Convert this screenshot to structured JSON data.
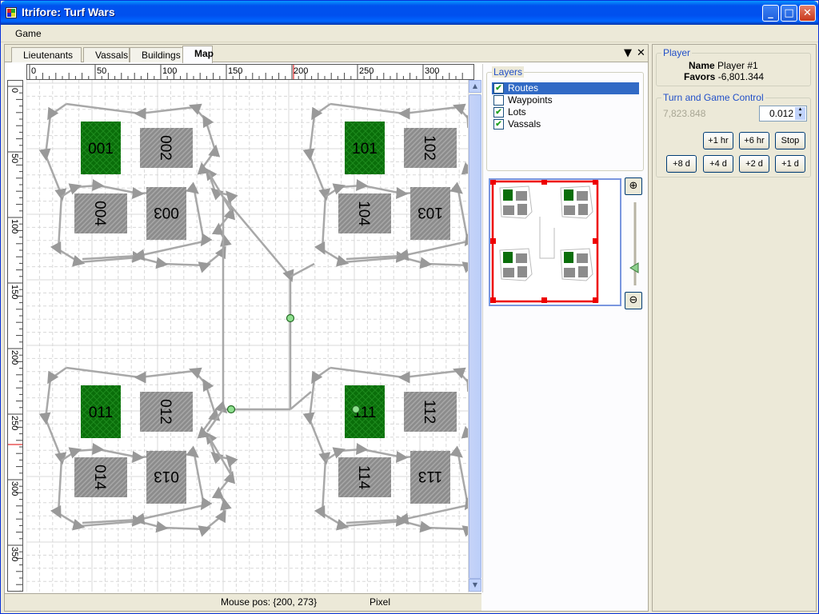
{
  "window": {
    "title": "Itrifore: Turf Wars",
    "minimize": "_",
    "maximize": "□",
    "close": "✕"
  },
  "menu": [
    "Game"
  ],
  "tabs": [
    "Lieutenants",
    "Vassals",
    "Buildings",
    "Map"
  ],
  "active_tab": "Map",
  "tab_controls": {
    "pin": "▼",
    "close": "✕"
  },
  "ruler": {
    "x_labels": [
      "0",
      "50",
      "100",
      "150",
      "200",
      "250",
      "300"
    ],
    "y_labels": [
      "0",
      "50",
      "100",
      "150",
      "200",
      "250",
      "300",
      "350"
    ]
  },
  "map": {
    "lots": [
      {
        "label": "001",
        "type": "owned",
        "flipped": false
      },
      {
        "label": "002",
        "type": "neutral",
        "flipped": true
      },
      {
        "label": "003",
        "type": "neutral",
        "flipped": true
      },
      {
        "label": "004",
        "type": "neutral",
        "flipped": true
      },
      {
        "label": "101",
        "type": "owned",
        "flipped": false
      },
      {
        "label": "102",
        "type": "neutral",
        "flipped": true
      },
      {
        "label": "103",
        "type": "neutral",
        "flipped": true
      },
      {
        "label": "104",
        "type": "neutral",
        "flipped": true
      },
      {
        "label": "011",
        "type": "owned",
        "flipped": false
      },
      {
        "label": "012",
        "type": "neutral",
        "flipped": true
      },
      {
        "label": "013",
        "type": "neutral",
        "flipped": true
      },
      {
        "label": "014",
        "type": "neutral",
        "flipped": true
      },
      {
        "label": "111",
        "type": "owned",
        "flipped": false
      },
      {
        "label": "112",
        "type": "neutral",
        "flipped": true
      },
      {
        "label": "113",
        "type": "neutral",
        "flipped": true
      },
      {
        "label": "114",
        "type": "neutral",
        "flipped": true
      }
    ]
  },
  "status": {
    "mouse": "Mouse pos: {200, 273}",
    "unit": "Pixel"
  },
  "layers": {
    "title": "Layers",
    "items": [
      {
        "label": "Routes",
        "checked": true,
        "selected": true
      },
      {
        "label": "Waypoints",
        "checked": false,
        "selected": false
      },
      {
        "label": "Lots",
        "checked": true,
        "selected": false
      },
      {
        "label": "Vassals",
        "checked": true,
        "selected": false
      }
    ]
  },
  "player": {
    "title": "Player",
    "name_label": "Name",
    "name": "Player #1",
    "favors_label": "Favors",
    "favors": "-6,801.344"
  },
  "turn": {
    "title": "Turn and Game Control",
    "time": "7,823.848",
    "speed": "0.012",
    "buttons_row1": [
      "+1 hr",
      "+6 hr",
      "Stop"
    ],
    "buttons_row2": [
      "+8 d",
      "+4 d",
      "+2 d",
      "+1 d"
    ]
  },
  "colors": {
    "owned": "#0a6e0a",
    "neutral": "#8c8c8c",
    "route": "#a8a8a8",
    "accent": "#316ac5"
  }
}
